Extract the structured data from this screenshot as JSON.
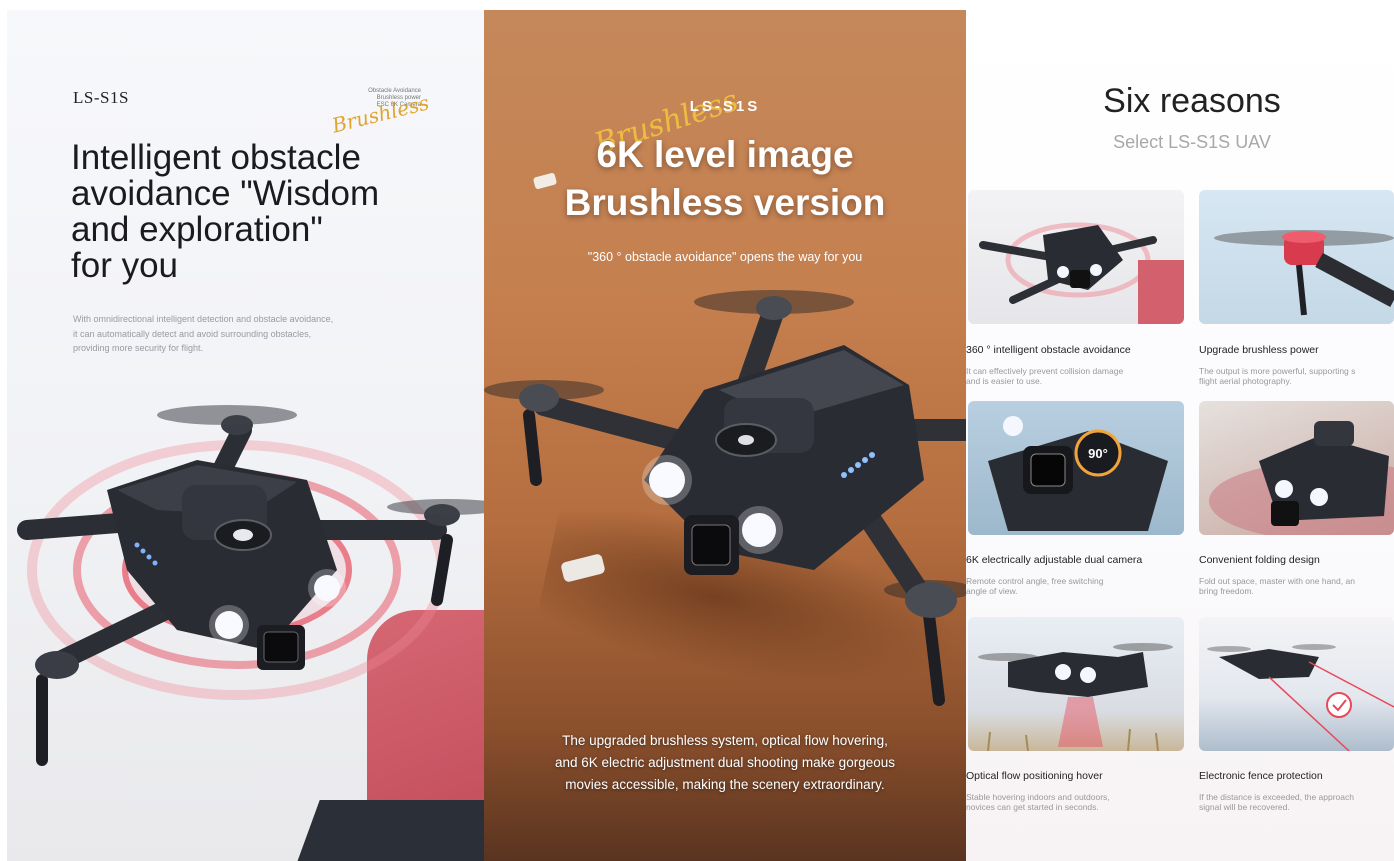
{
  "panel1": {
    "model": "LS-S1S",
    "signature": {
      "lines": [
        "Obstacle Avoidance",
        "Brushless power",
        "ESC 6K Camera"
      ],
      "script": "Brushless"
    },
    "title_lines": [
      "Intelligent obstacle",
      "avoidance \"Wisdom",
      "and exploration\"",
      "for you"
    ],
    "desc_lines": [
      "With omnidirectional intelligent detection and obstacle avoidance,",
      "it can automatically detect and avoid surrounding obstacles,",
      "providing more security for flight."
    ]
  },
  "panel2": {
    "signature_script": "Brushless",
    "model": "LS-S1S",
    "title_lines": [
      "6K level image",
      "Brushless version"
    ],
    "subtitle": "\"360 ° obstacle avoidance\" opens the way for you",
    "desc_lines": [
      "The upgraded brushless system, optical flow hovering,",
      "and 6K electric adjustment dual shooting make gorgeous",
      "movies accessible, making the scenery extraordinary."
    ]
  },
  "panel3": {
    "title": "Six reasons",
    "subtitle": "Select LS-S1S UAV",
    "cards": [
      {
        "title": "360 ° intelligent obstacle avoidance",
        "desc1": "It can effectively prevent collision damage",
        "desc2": "and is easier to use."
      },
      {
        "title": "Upgrade brushless power",
        "desc1": "The output is more powerful, supporting s",
        "desc2": "flight aerial photography."
      },
      {
        "title": "6K electrically adjustable dual camera",
        "desc1": "Remote control angle, free switching",
        "desc2": "angle of view."
      },
      {
        "title": "Convenient folding design",
        "desc1": "Fold out space, master with one hand, an",
        "desc2": "bring freedom."
      },
      {
        "title": "Optical flow positioning hover",
        "desc1": "Stable hovering indoors and outdoors,",
        "desc2": "novices can get started in seconds."
      },
      {
        "title": "Electronic fence protection",
        "desc1": "If the distance is exceeded, the approach",
        "desc2": "signal will be recovered."
      }
    ],
    "badge": "90°"
  },
  "colors": {
    "panel2_sand": "#c3814f",
    "accent_red": "#e0495a",
    "signature_gold": "#e0a530"
  }
}
